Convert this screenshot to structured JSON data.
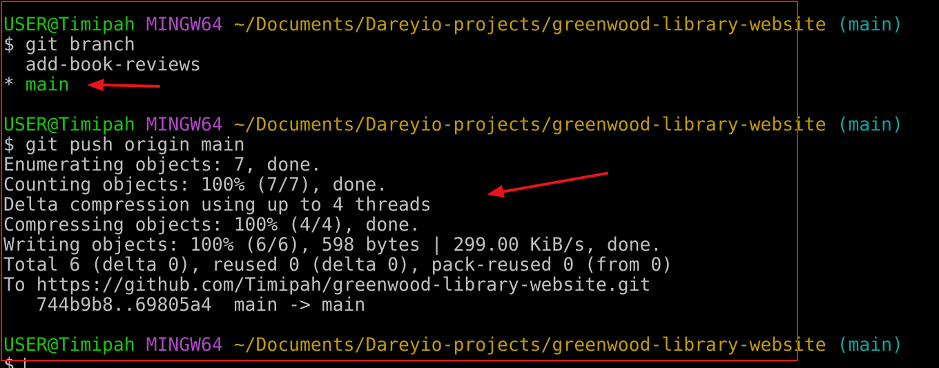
{
  "colors": {
    "background": "#000000",
    "text": "#c0c0c0",
    "user": "#16c60c",
    "host": "#b148c6",
    "path": "#c19c00",
    "branch": "#0aa5a5",
    "annotation": "#e8141c"
  },
  "prompt": {
    "user": "USER@Timipah",
    "host": "MINGW64",
    "path": "~/Documents/Dareyio-projects/greenwood-library-website",
    "branch": "(main)",
    "symbol": "$"
  },
  "block1": {
    "command": "git branch",
    "branches": [
      "add-book-reviews",
      "main"
    ],
    "current_marker": "*"
  },
  "block2": {
    "command": "git push origin main",
    "output": [
      "Enumerating objects: 7, done.",
      "Counting objects: 100% (7/7), done.",
      "Delta compression using up to 4 threads",
      "Compressing objects: 100% (4/4), done.",
      "Writing objects: 100% (6/6), 598 bytes | 299.00 KiB/s, done.",
      "Total 6 (delta 0), reused 0 (delta 0), pack-reused 0 (from 0)",
      "To https://github.com/Timipah/greenwood-library-website.git",
      "   744b9b8..69805a4  main -> main"
    ]
  },
  "annotations": [
    "arrow",
    "arrow",
    "highlight-box"
  ]
}
